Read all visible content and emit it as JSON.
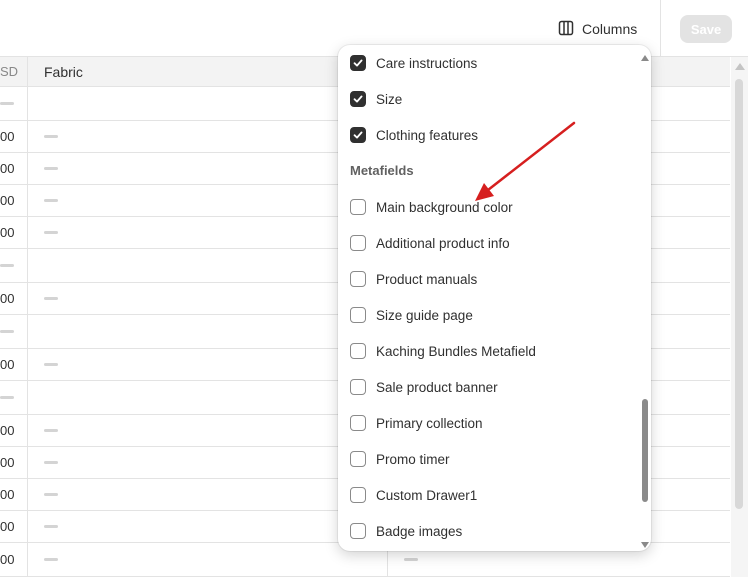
{
  "toolbar": {
    "columns_label": "Columns",
    "save_label": "Save"
  },
  "table": {
    "headers": {
      "price_partial": "SD",
      "fabric": "Fabric"
    },
    "rows": [
      {
        "price": ""
      },
      {
        "price": "00"
      },
      {
        "price": "00"
      },
      {
        "price": "00"
      },
      {
        "price": "00"
      },
      {
        "price": ""
      },
      {
        "price": "00"
      },
      {
        "price": ""
      },
      {
        "price": "00"
      },
      {
        "price": ""
      },
      {
        "price": "00"
      },
      {
        "price": "00"
      },
      {
        "price": "00"
      },
      {
        "price": "00"
      },
      {
        "price": "00"
      }
    ]
  },
  "columns_menu": {
    "checked_items": [
      {
        "label": "Care instructions",
        "checked": true
      },
      {
        "label": "Size",
        "checked": true
      },
      {
        "label": "Clothing features",
        "checked": true
      }
    ],
    "section_label": "Metafields",
    "metafield_items": [
      {
        "label": "Main background color",
        "checked": false
      },
      {
        "label": "Additional product info",
        "checked": false
      },
      {
        "label": "Product manuals",
        "checked": false
      },
      {
        "label": "Size guide page",
        "checked": false
      },
      {
        "label": "Kaching Bundles Metafield",
        "checked": false
      },
      {
        "label": "Sale product banner",
        "checked": false
      },
      {
        "label": "Primary collection",
        "checked": false
      },
      {
        "label": "Promo timer",
        "checked": false
      },
      {
        "label": "Custom Drawer1",
        "checked": false
      },
      {
        "label": "Badge images",
        "checked": false
      }
    ]
  },
  "colors": {
    "annotation_arrow": "#d61f1f",
    "checkbox_checked": "#303030"
  },
  "icons": {
    "columns": "columns-icon",
    "checkmark": "checkmark-icon"
  }
}
